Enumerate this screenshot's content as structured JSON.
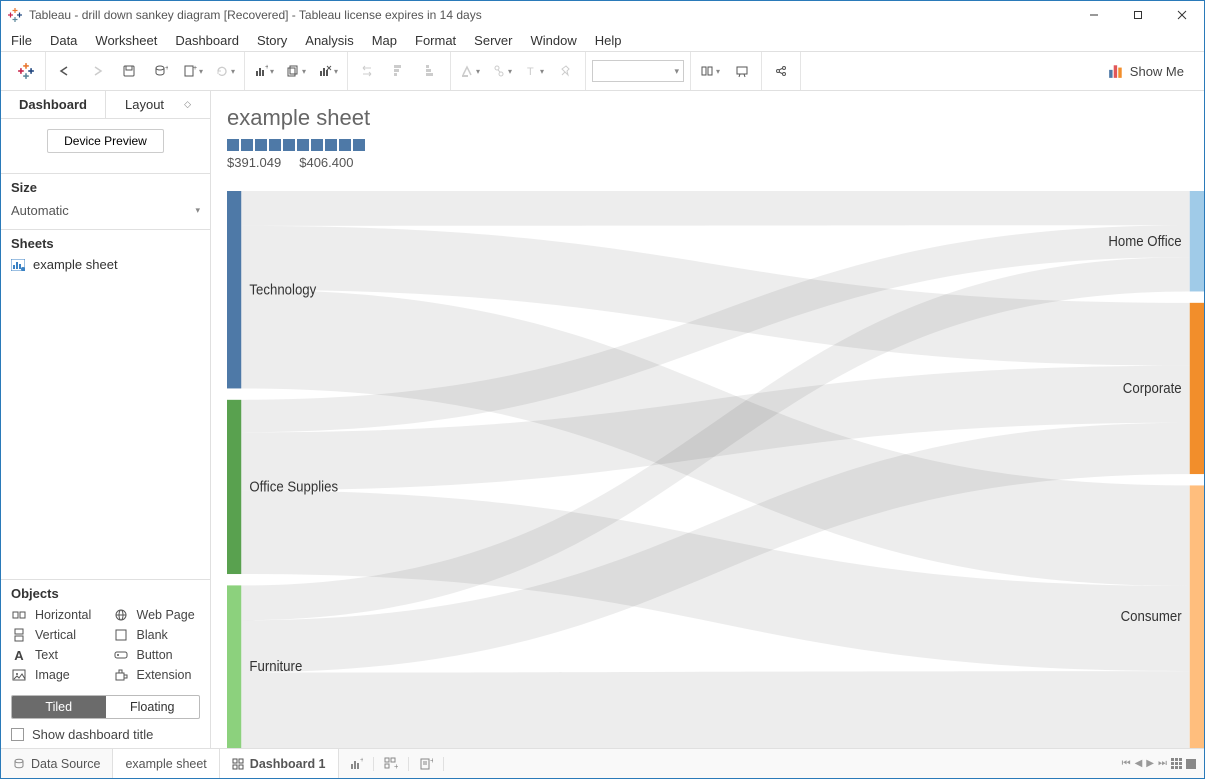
{
  "window": {
    "title": "Tableau - drill down sankey diagram [Recovered] - Tableau license expires in 14 days"
  },
  "menu": [
    "File",
    "Data",
    "Worksheet",
    "Dashboard",
    "Story",
    "Analysis",
    "Map",
    "Format",
    "Server",
    "Window",
    "Help"
  ],
  "showme_label": "Show Me",
  "side": {
    "tabs": {
      "dashboard": "Dashboard",
      "layout": "Layout"
    },
    "device_preview": "Device Preview",
    "size_label": "Size",
    "size_value": "Automatic",
    "sheets_label": "Sheets",
    "sheet_item": "example sheet",
    "objects_label": "Objects",
    "objects": [
      "Horizontal",
      "Web Page",
      "Vertical",
      "Blank",
      "Text",
      "Button",
      "Image",
      "Extension"
    ],
    "tiled": "Tiled",
    "floating": "Floating",
    "show_title": "Show dashboard title"
  },
  "canvas": {
    "title": "example sheet",
    "legend_min": "$391.049",
    "legend_max": "$406.400"
  },
  "chart_data": {
    "type": "sankey",
    "left_nodes": [
      {
        "name": "Technology",
        "color": "#4e79a7",
        "size": 170
      },
      {
        "name": "Office Supplies",
        "color": "#59a14f",
        "size": 150
      },
      {
        "name": "Furniture",
        "color": "#8cd17d",
        "size": 140
      }
    ],
    "right_nodes": [
      {
        "name": "Home Office",
        "color": "#a0cbe8",
        "size": 88
      },
      {
        "name": "Corporate",
        "color": "#f28e2b",
        "size": 150
      },
      {
        "name": "Consumer",
        "color": "#ffbe7d",
        "size": 230
      }
    ],
    "links": [
      {
        "from": "Technology",
        "to": "Home Office",
        "weight": 30
      },
      {
        "from": "Technology",
        "to": "Corporate",
        "weight": 55
      },
      {
        "from": "Technology",
        "to": "Consumer",
        "weight": 85
      },
      {
        "from": "Office Supplies",
        "to": "Home Office",
        "weight": 28
      },
      {
        "from": "Office Supplies",
        "to": "Corporate",
        "weight": 50
      },
      {
        "from": "Office Supplies",
        "to": "Consumer",
        "weight": 72
      },
      {
        "from": "Furniture",
        "to": "Home Office",
        "weight": 30
      },
      {
        "from": "Furniture",
        "to": "Corporate",
        "weight": 45
      },
      {
        "from": "Furniture",
        "to": "Consumer",
        "weight": 65
      }
    ]
  },
  "bottom": {
    "data_source": "Data Source",
    "sheet": "example sheet",
    "dashboard": "Dashboard 1"
  }
}
